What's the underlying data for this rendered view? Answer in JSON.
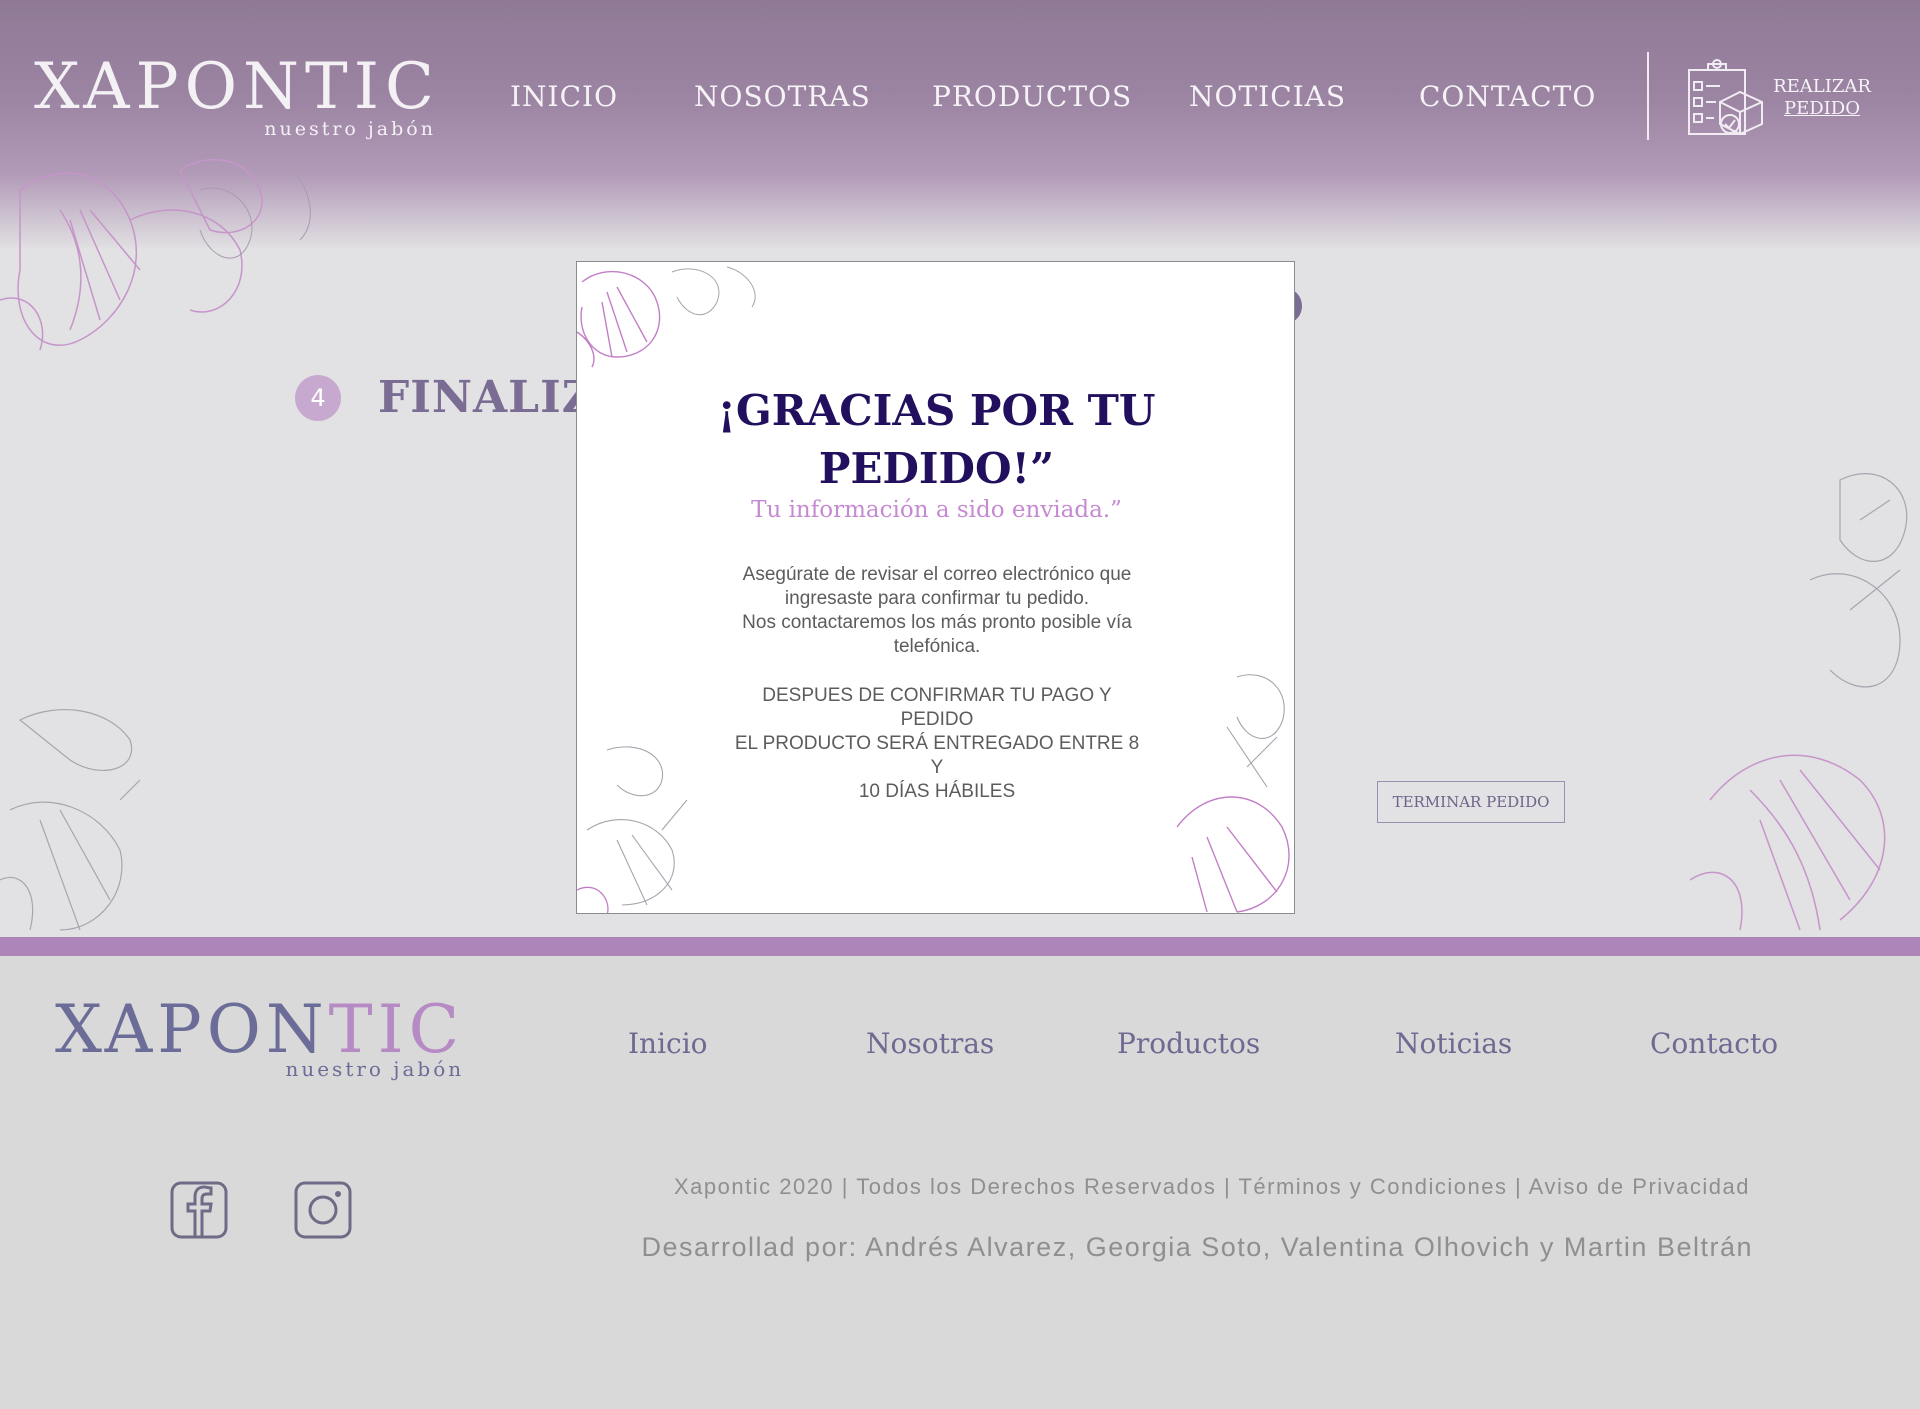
{
  "header": {
    "logo_word": "XAPONTIC",
    "logo_tagline": "nuestro jabón",
    "nav": [
      "INICIO",
      "NOSOTRAS",
      "PRODUCTOS",
      "NOTICIAS",
      "CONTACTO"
    ],
    "order_cta": {
      "line1": "REALIZAR",
      "line2": "PEDIDO",
      "icon": "clipboard-package-icon"
    }
  },
  "checkout": {
    "step_number": "4",
    "step_title": "FINALIZA",
    "finish_button": "TERMINAR PEDIDO"
  },
  "modal": {
    "title_line1": "¡GRACIAS POR TU",
    "title_line2": "PEDIDO!”",
    "subtitle": "Tu información a sido enviada.”",
    "body_lines": [
      "Asegúrate de revisar el correo electrónico que",
      "ingresaste para confirmar tu pedido.",
      "Nos contactaremos los más pronto posible vía",
      "telefónica."
    ],
    "notice_lines": [
      "DESPUES DE CONFIRMAR TU PAGO Y PEDIDO",
      "EL PRODUCTO SERÁ ENTREGADO ENTRE 8 Y",
      "10 DÍAS HÁBILES"
    ]
  },
  "footer": {
    "logo_part1": "XAPON",
    "logo_part2": "TIC",
    "logo_tagline": "nuestro jabón",
    "links": [
      "Inicio",
      "Nosotras",
      "Productos",
      "Noticias",
      "Contacto"
    ],
    "social": [
      "facebook-icon",
      "instagram-icon"
    ],
    "legal": "Xapontic 2020 | Todos los Derechos Reservados | Términos y Condiciones | Aviso de Privacidad",
    "credits": "Desarrollad por: Andrés Alvarez, Georgia Soto, Valentina Olhovich y Martin Beltrán"
  },
  "colors": {
    "header_purple": "#8f7a96",
    "accent_lilac": "#ad85b8",
    "modal_title": "#22105e",
    "modal_subtitle": "#c68ad2",
    "footer_bg": "#d9d9d9"
  }
}
